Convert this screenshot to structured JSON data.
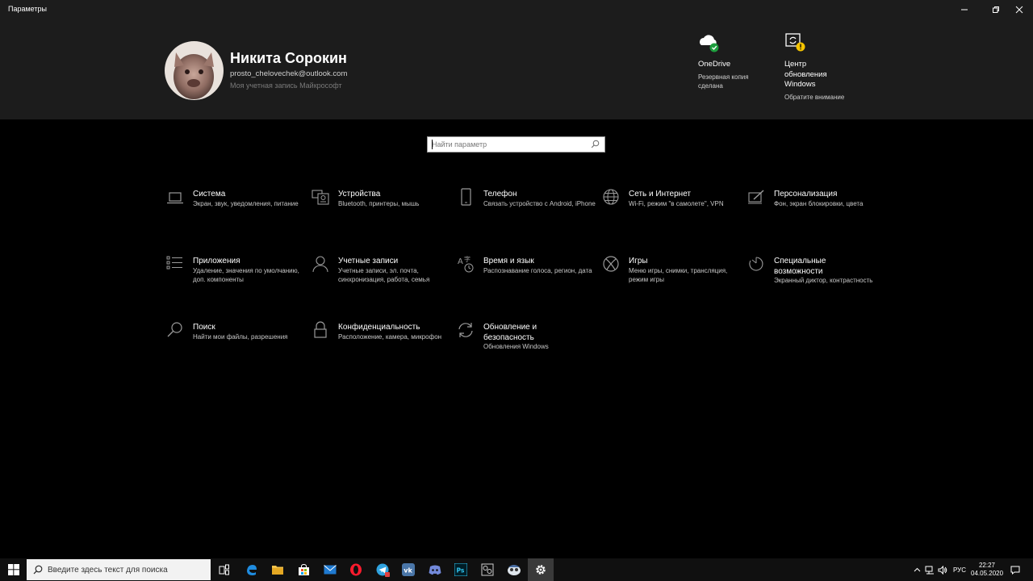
{
  "window": {
    "title": "Параметры"
  },
  "user": {
    "name": "Никита Сорокин",
    "email": "prosto_chelovechek@outlook.com",
    "account_link": "Моя учетная запись Майкрософт"
  },
  "status_items": [
    {
      "icon": "onedrive-cloud-check-icon",
      "title": "OneDrive",
      "subtitle": "Резервная копия сделана",
      "badge_color": "#1e9e3e"
    },
    {
      "icon": "windows-update-warning-icon",
      "title": "Центр обновления Windows",
      "subtitle": "Обратите внимание",
      "badge_color": "#f5c400"
    }
  ],
  "search": {
    "placeholder": "Найти параметр"
  },
  "tiles": [
    {
      "icon": "laptop-icon",
      "title": "Система",
      "description": "Экран, звук, уведомления, питание"
    },
    {
      "icon": "keyboard-devices-icon",
      "title": "Устройства",
      "description": "Bluetooth, принтеры, мышь"
    },
    {
      "icon": "phone-icon",
      "title": "Телефон",
      "description": "Связать устройство с Android, iPhone"
    },
    {
      "icon": "globe-icon",
      "title": "Сеть и Интернет",
      "description": "Wi-Fi, режим \"в самолете\", VPN"
    },
    {
      "icon": "pen-screen-icon",
      "title": "Персонализация",
      "description": "Фон, экран блокировки, цвета"
    },
    {
      "icon": "apps-list-icon",
      "title": "Приложения",
      "description": "Удаление, значения по умолчанию, доп. компоненты"
    },
    {
      "icon": "person-icon",
      "title": "Учетные записи",
      "description": "Учетные записи, эл. почта, синхронизация, работа, семья"
    },
    {
      "icon": "time-language-icon",
      "title": "Время и язык",
      "description": "Распознавание голоса, регион, дата"
    },
    {
      "icon": "xbox-icon",
      "title": "Игры",
      "description": "Меню игры, снимки, трансляция, режим игры"
    },
    {
      "icon": "accessibility-timer-icon",
      "title": "Специальные возможности",
      "description": "Экранный диктор, контрастность"
    },
    {
      "icon": "search-icon",
      "title": "Поиск",
      "description": "Найти мои файлы, разрешения"
    },
    {
      "icon": "lock-icon",
      "title": "Конфиденциальность",
      "description": "Расположение, камера, микрофон"
    },
    {
      "icon": "sync-arrows-icon",
      "title": "Обновление и безопасность",
      "description": "Обновления Windows"
    }
  ],
  "taskbar": {
    "search_placeholder": "Введите здесь текст для поиска",
    "apps": [
      "task-view-icon",
      "edge-icon",
      "file-explorer-icon",
      "store-icon",
      "mail-icon",
      "opera-icon",
      "telegram-icon",
      "vk-icon",
      "discord-icon",
      "photoshop-icon",
      "control-panel-icon",
      "app-icon",
      "settings-gear-icon"
    ],
    "language": "РУС",
    "time": "22:27",
    "date": "04.05.2020"
  },
  "colors": {
    "background": "#000000",
    "header_background": "#1c1c1c",
    "icon_gray": "#9a9a9a",
    "onedrive_green": "#1e9e3e",
    "update_yellow": "#f5c400"
  }
}
